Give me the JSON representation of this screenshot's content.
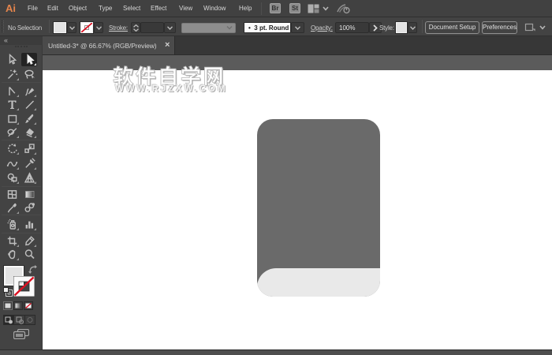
{
  "window": {
    "logo_text": "Ai"
  },
  "menu_bar": {
    "items": [
      "File",
      "Edit",
      "Object",
      "Type",
      "Select",
      "Effect",
      "View",
      "Window",
      "Help"
    ],
    "bridge_button": "Br",
    "stock_button": "St",
    "icons": [
      "workspace-switcher-icon",
      "chevron-down-icon",
      "cs-live-icon"
    ]
  },
  "control_bar": {
    "no_selection_label": "No Selection",
    "fill_swatch_color": "#e3e3e3",
    "stroke_swatch": "none",
    "stroke_label": "Stroke:",
    "stroke_weight_value": "",
    "brush_bullet": "•",
    "brush_definition": "3 pt. Round",
    "opacity_label": "Opacity:",
    "opacity_value": "100%",
    "opacity_flyout_glyph": "›",
    "style_label": "Style:",
    "document_setup_button": "Document Setup",
    "preferences_button": "Preferences",
    "icons": [
      "fill-swatch",
      "stroke-none-swatch",
      "stroke-weight-stepper",
      "variable-width-profile-dropdown",
      "brush-dropdown",
      "style-swatch",
      "arrange-documents-icon",
      "chevron-down-icon"
    ]
  },
  "document_tab": {
    "title": "Untitled-3* @ 66.67% (RGB/Preview)",
    "close_glyph": "×"
  },
  "tools_panel": {
    "collapse_glyph": "«",
    "selected_tool": "direct-selection",
    "rows": [
      [
        "selection",
        "direct-selection"
      ],
      [
        "magic-wand",
        "lasso"
      ],
      [
        "pen",
        "ink-brush"
      ],
      [
        "type",
        "line-segment"
      ],
      [
        "rectangle",
        "paintbrush"
      ],
      [
        "pencil",
        "eraser"
      ],
      [
        "rotate",
        "scale"
      ],
      [
        "width",
        "free-transform"
      ],
      [
        "shape-builder",
        "perspective-grid"
      ],
      [
        "mesh",
        "gradient"
      ],
      [
        "eyedropper",
        "blend"
      ],
      [
        "symbol-sprayer",
        "column-graph"
      ],
      [
        "artboard",
        "slice"
      ],
      [
        "hand",
        "zoom"
      ]
    ],
    "flyout_tools": [
      "direct-selection",
      "magic-wand",
      "pen",
      "ink-brush",
      "type",
      "line-segment",
      "rectangle",
      "paintbrush",
      "pencil",
      "eraser",
      "rotate",
      "scale",
      "width",
      "free-transform",
      "shape-builder",
      "perspective-grid",
      "eyedropper",
      "symbol-sprayer",
      "column-graph",
      "artboard",
      "slice",
      "hand"
    ],
    "fill_color": "#e3e3e3",
    "stroke": "none",
    "bottom_controls": [
      "swap-fill-stroke-icon",
      "default-fill-stroke-icon",
      "color-button",
      "gradient-button",
      "none-button",
      "draw-normal-mode",
      "draw-behind-mode",
      "draw-inside-mode",
      "screen-mode-button"
    ]
  },
  "watermark": {
    "title": "软件自学网",
    "url": "WWW.RJZXW.COM"
  },
  "artwork": {
    "book_cover_color": "#6a6a6a",
    "book_pages_color": "#e9e9e9"
  },
  "colors": {
    "chrome": "#424242",
    "tab_bar": "#373737",
    "active_tab": "#4b4b4b",
    "pasteboard": "#5a5a5a",
    "artboard": "#ffffff",
    "logo_orange": "#e5854c",
    "stroke_none_red": "#dd1021",
    "icon_gray": "#b9b9b9"
  }
}
